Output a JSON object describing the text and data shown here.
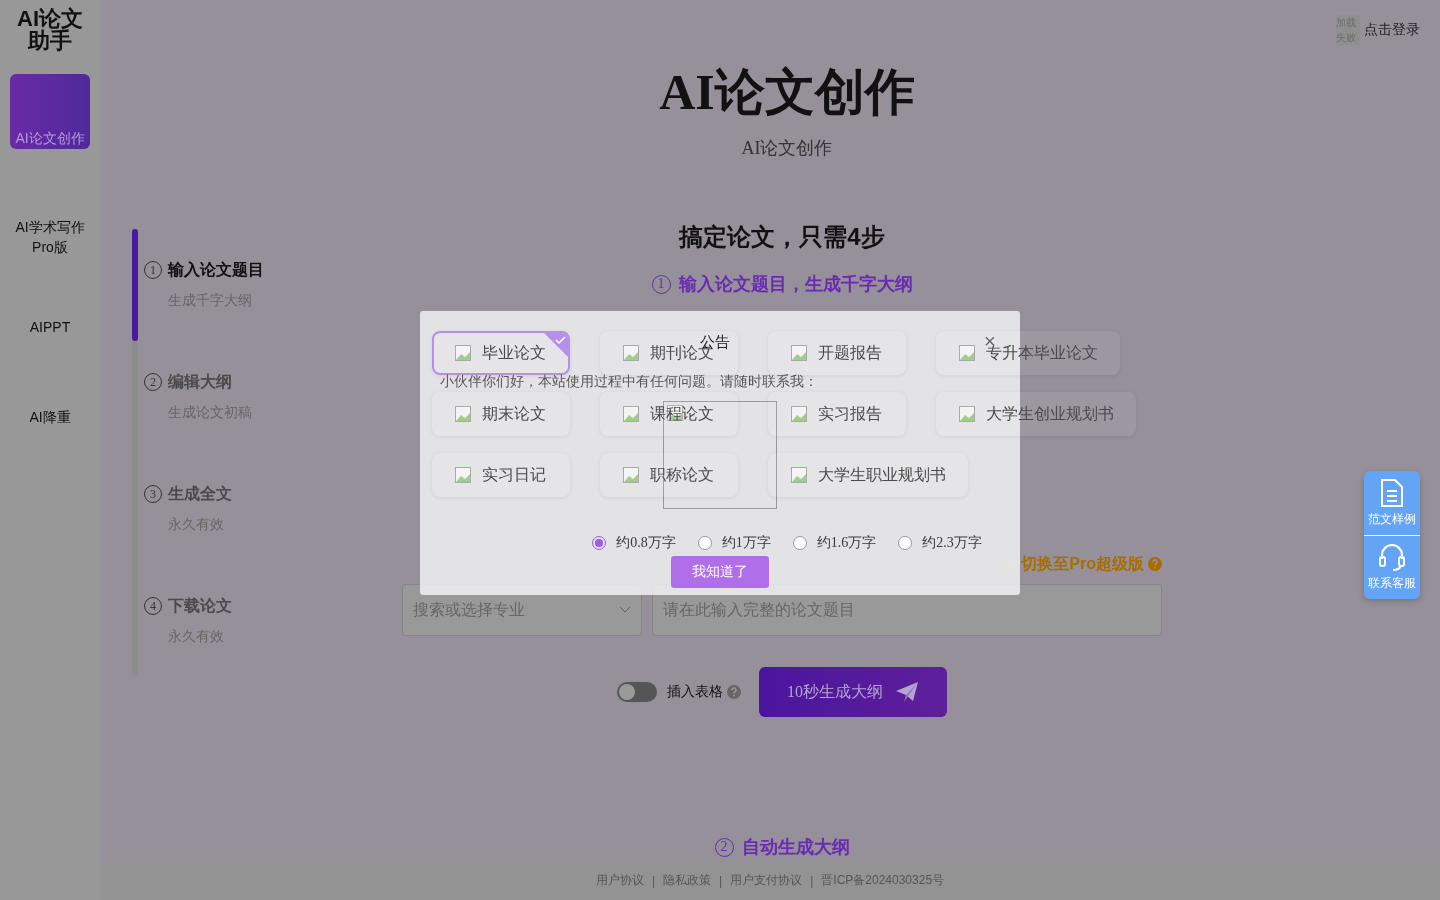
{
  "sidebar": {
    "logo_lines": [
      "AI论文",
      "助手"
    ],
    "items": [
      {
        "label": "AI论文创作",
        "selected": true
      },
      {
        "label": "AI学术写作Pro版",
        "selected": false
      },
      {
        "label": "AIPPT",
        "selected": false
      },
      {
        "label": "AI降重",
        "selected": false
      }
    ]
  },
  "header": {
    "avatar_alt": "加载失败",
    "login": "点击登录"
  },
  "hero": {
    "title": "AI论文创作",
    "subtitle": "AI论文创作"
  },
  "steps": {
    "level": 0.25,
    "items": [
      {
        "number": "1",
        "title": "输入论文题目",
        "subtitle": "生成千字大纲",
        "selected": true
      },
      {
        "number": "2",
        "title": "编辑大纲",
        "subtitle": "生成论文初稿",
        "selected": false
      },
      {
        "number": "3",
        "title": "生成全文",
        "subtitle": "永久有效",
        "selected": false
      },
      {
        "number": "4",
        "title": "下载论文",
        "subtitle": "永久有效",
        "selected": false
      }
    ]
  },
  "form": {
    "heading": "搞定论文，只需4步",
    "step_label": {
      "number": "1",
      "text": "输入论文题目，生成千字大纲"
    },
    "paper_types": [
      [
        {
          "label": "毕业论文",
          "selected": true
        },
        {
          "label": "期刊论文",
          "selected": false
        },
        {
          "label": "开题报告",
          "selected": false
        },
        {
          "label": "专升本毕业论文",
          "selected": false
        }
      ],
      [
        {
          "label": "期末论文",
          "selected": false
        },
        {
          "label": "课程论文",
          "selected": false
        },
        {
          "label": "实习报告",
          "selected": false
        },
        {
          "label": "大学生创业规划书",
          "selected": false
        }
      ],
      [
        {
          "label": "实习日记",
          "selected": false
        },
        {
          "label": "职称论文",
          "selected": false
        },
        {
          "label": "大学生职业规划书",
          "selected": false
        }
      ]
    ],
    "word_counts": [
      {
        "label": "约0.8万字",
        "selected": true
      },
      {
        "label": "约1万字",
        "selected": false
      },
      {
        "label": "约1.6万字",
        "selected": false
      },
      {
        "label": "约2.3万字",
        "selected": false
      }
    ],
    "pro_switch": "切换至Pro超级版",
    "major_select": {
      "placeholder": "搜索或选择专业"
    },
    "title_input": {
      "placeholder": "请在此输入完整的论文题目"
    },
    "table_toggle": {
      "label": "插入表格",
      "on": false
    },
    "generate_button": "10秒生成大纲",
    "next_step_label": {
      "number": "2",
      "text": "自动生成大纲"
    }
  },
  "float_buttons": [
    {
      "kind": "document",
      "label": "范文样例"
    },
    {
      "kind": "headset",
      "label": "联系客服"
    }
  ],
  "footer": {
    "links": [
      "用户协议",
      "隐私政策",
      "用户支付协议",
      "晋ICP备2024030325号"
    ],
    "separators": [
      "|",
      "|",
      "|"
    ]
  },
  "dialog": {
    "title": "公告",
    "close": "×",
    "message": "小伙伴你们好，本站使用过程中有任何问题。请随时联系我：",
    "button": "我知道了"
  }
}
